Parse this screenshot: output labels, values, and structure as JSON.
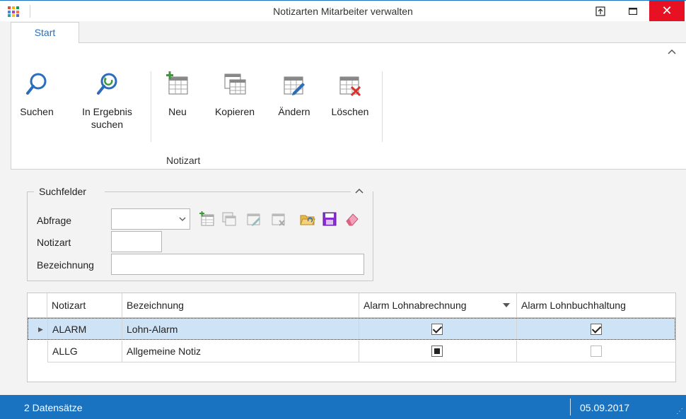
{
  "window": {
    "title": "Notizarten Mitarbeiter verwalten",
    "close_glyph": "✕"
  },
  "ribbon": {
    "tab_label": "Start",
    "buttons": {
      "suchen": "Suchen",
      "in_ergebnis_line1": "In Ergebnis",
      "in_ergebnis_line2": "suchen",
      "neu": "Neu",
      "kopieren": "Kopieren",
      "aendern": "Ändern",
      "loeschen": "Löschen"
    },
    "group_label": "Notizart"
  },
  "search": {
    "title": "Suchfelder",
    "labels": {
      "abfrage": "Abfrage",
      "notizart": "Notizart",
      "bezeichnung": "Bezeichnung"
    },
    "values": {
      "abfrage": "",
      "notizart": "",
      "bezeichnung": ""
    }
  },
  "grid": {
    "columns": [
      "Notizart",
      "Bezeichnung",
      "Alarm Lohnabrechnung",
      "Alarm Lohnbuchhaltung"
    ],
    "rows": [
      {
        "notizart": "ALARM",
        "bezeichnung": "Lohn-Alarm",
        "alarm_lohnabrechnung": "checked",
        "alarm_lohnbuchhaltung": "checked"
      },
      {
        "notizart": "ALLG",
        "bezeichnung": "Allgemeine Notiz",
        "alarm_lohnabrechnung": "indeterminate",
        "alarm_lohnbuchhaltung": "unchecked"
      }
    ]
  },
  "status": {
    "count": "2 Datensätze",
    "date": "05.09.2017"
  },
  "colors": {
    "accent": "#1a73c0",
    "close": "#e81123",
    "selection": "#cfe3f7"
  }
}
